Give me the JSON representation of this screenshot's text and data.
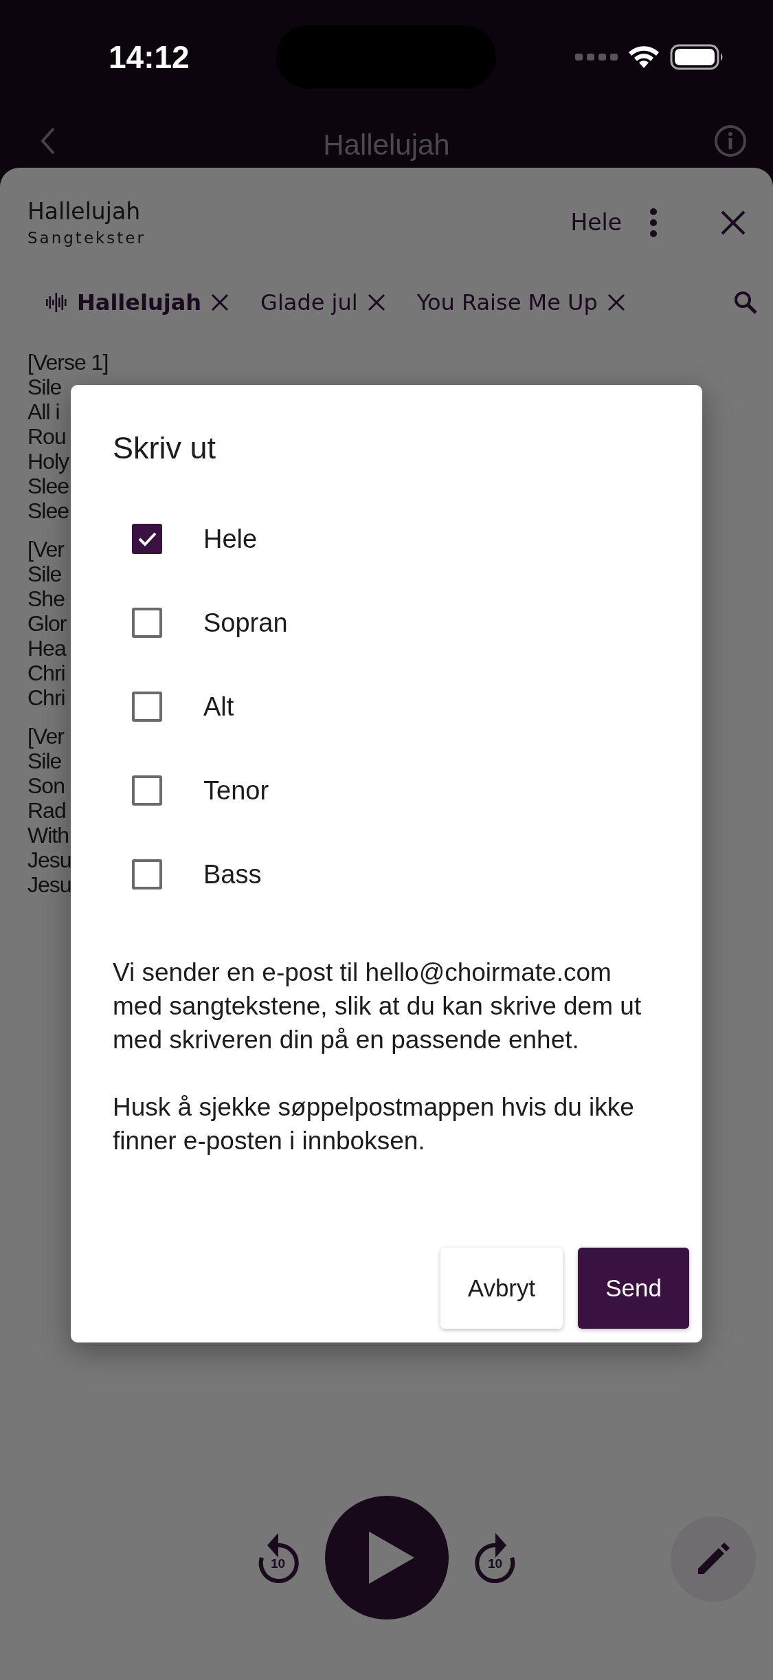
{
  "status_bar": {
    "time": "14:12"
  },
  "nav": {
    "title": "Hallelujah"
  },
  "sheet": {
    "title": "Hallelujah",
    "subtitle": "Sangtekster",
    "voice": "Hele"
  },
  "tabs": [
    {
      "label": "Hallelujah",
      "selected": true
    },
    {
      "label": "Glade jul",
      "selected": false
    },
    {
      "label": "You Raise Me Up",
      "selected": false
    }
  ],
  "lyrics": [
    [
      "[Verse 1]",
      "Sile",
      "All i",
      "Rou",
      "Holy",
      "Slee",
      "Slee"
    ],
    [
      "[Ver",
      "Sile",
      "She",
      "Glor",
      "Hea",
      "Chri",
      "Chri"
    ],
    [
      "[Ver",
      "Sile",
      "Son",
      "Rad",
      "With",
      "Jesu",
      "Jesu"
    ]
  ],
  "dialog": {
    "title": "Skriv ut",
    "options": [
      {
        "label": "Hele",
        "checked": true
      },
      {
        "label": "Sopran",
        "checked": false
      },
      {
        "label": "Alt",
        "checked": false
      },
      {
        "label": "Tenor",
        "checked": false
      },
      {
        "label": "Bass",
        "checked": false
      }
    ],
    "paragraphs": [
      "Vi sender en e-post til hello@choirmate.com med sangtekstene, slik at du kan skrive dem ut med skriveren din på en passende enhet.",
      "Husk å sjekke søppelpostmappen hvis du ikke finner e-posten i innboksen."
    ],
    "buttons": [
      {
        "label": "Avbryt",
        "kind": "secondary"
      },
      {
        "label": "Send",
        "kind": "primary"
      }
    ]
  },
  "player": {
    "rewind_label": "10",
    "forward_label": "10"
  }
}
